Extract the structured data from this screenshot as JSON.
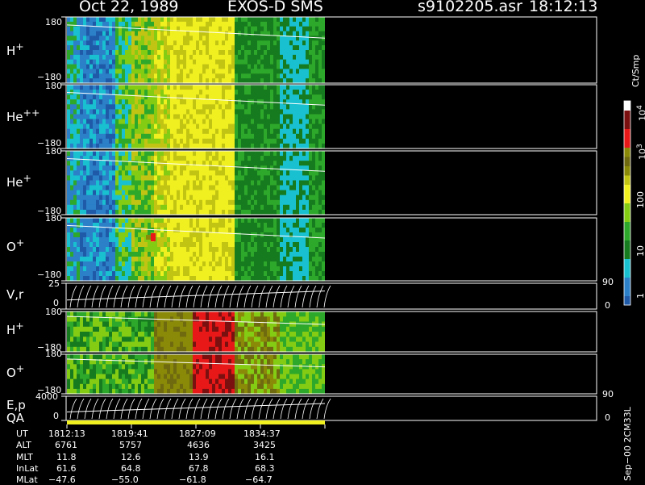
{
  "header": {
    "date": "Oct 22, 1989",
    "instrument": "EXOS-D SMS",
    "file": "s9102205.asr",
    "time": "18:12:13"
  },
  "colors": {
    "dark_blue": "#1f5aa8",
    "blue": "#2b80c8",
    "cyan": "#18c0d0",
    "dark_green": "#167a1e",
    "green": "#2ea82a",
    "light_green": "#84cc14",
    "yellow_green": "#c2c414",
    "olive": "#8a8a08",
    "dark_olive": "#6f6a10",
    "yellow": "#f0f020",
    "red": "#e81818",
    "dark_red": "#7a1010",
    "white": "#ffffff"
  },
  "chart_data": {
    "type": "heatmap",
    "ut_range": [
      "18:12:13",
      "18:34:37"
    ],
    "panels": [
      {
        "id": "hp",
        "label": "H",
        "sup": "+",
        "ymax": "180",
        "ymin": "−180"
      },
      {
        "id": "hepp",
        "label": "He",
        "sup": "++",
        "ymax": "180",
        "ymin": "−180"
      },
      {
        "id": "hep",
        "label": "He",
        "sup": "+",
        "ymax": "180",
        "ymin": "−180"
      },
      {
        "id": "op",
        "label": "O",
        "sup": "+",
        "ymax": "180",
        "ymin": "−180"
      },
      {
        "id": "vr",
        "label": "V,r",
        "sup": "",
        "ymax": "25",
        "ymin": "0",
        "right_top": "90",
        "right_bot": "0"
      },
      {
        "id": "hp2",
        "label": "H",
        "sup": "+",
        "ymax": "180",
        "ymin": "−180"
      },
      {
        "id": "op2",
        "label": "O",
        "sup": "+",
        "ymax": "180",
        "ymin": "−180"
      },
      {
        "id": "ep",
        "label": "E,p",
        "sup": "",
        "ymax": "4000",
        "ymin": "0",
        "right_top": "90",
        "right_bot": "0"
      }
    ],
    "qa_label": "QA",
    "colorbar": {
      "unit": "Ct/Smp",
      "ticks": [
        {
          "label": "1",
          "exp": ""
        },
        {
          "label": "10",
          "exp": ""
        },
        {
          "label": "100",
          "exp": ""
        },
        {
          "label": "10",
          "exp": "3"
        },
        {
          "label": "10",
          "exp": "4"
        }
      ]
    },
    "ephemeris": {
      "labels": [
        "UT",
        "ALT",
        "MLT",
        "InLat",
        "MLat"
      ],
      "columns": [
        [
          "1812:13",
          "6761",
          "11.8",
          "61.6",
          "−47.6"
        ],
        [
          "1819:41",
          "5757",
          "12.6",
          "64.8",
          "−55.0"
        ],
        [
          "1827:09",
          "4636",
          "13.9",
          "67.8",
          "−61.8"
        ],
        [
          "1834:37",
          "3425",
          "16.1",
          "68.3",
          "−64.7"
        ]
      ]
    },
    "footer_note": "Sep−00 2CM33L"
  }
}
